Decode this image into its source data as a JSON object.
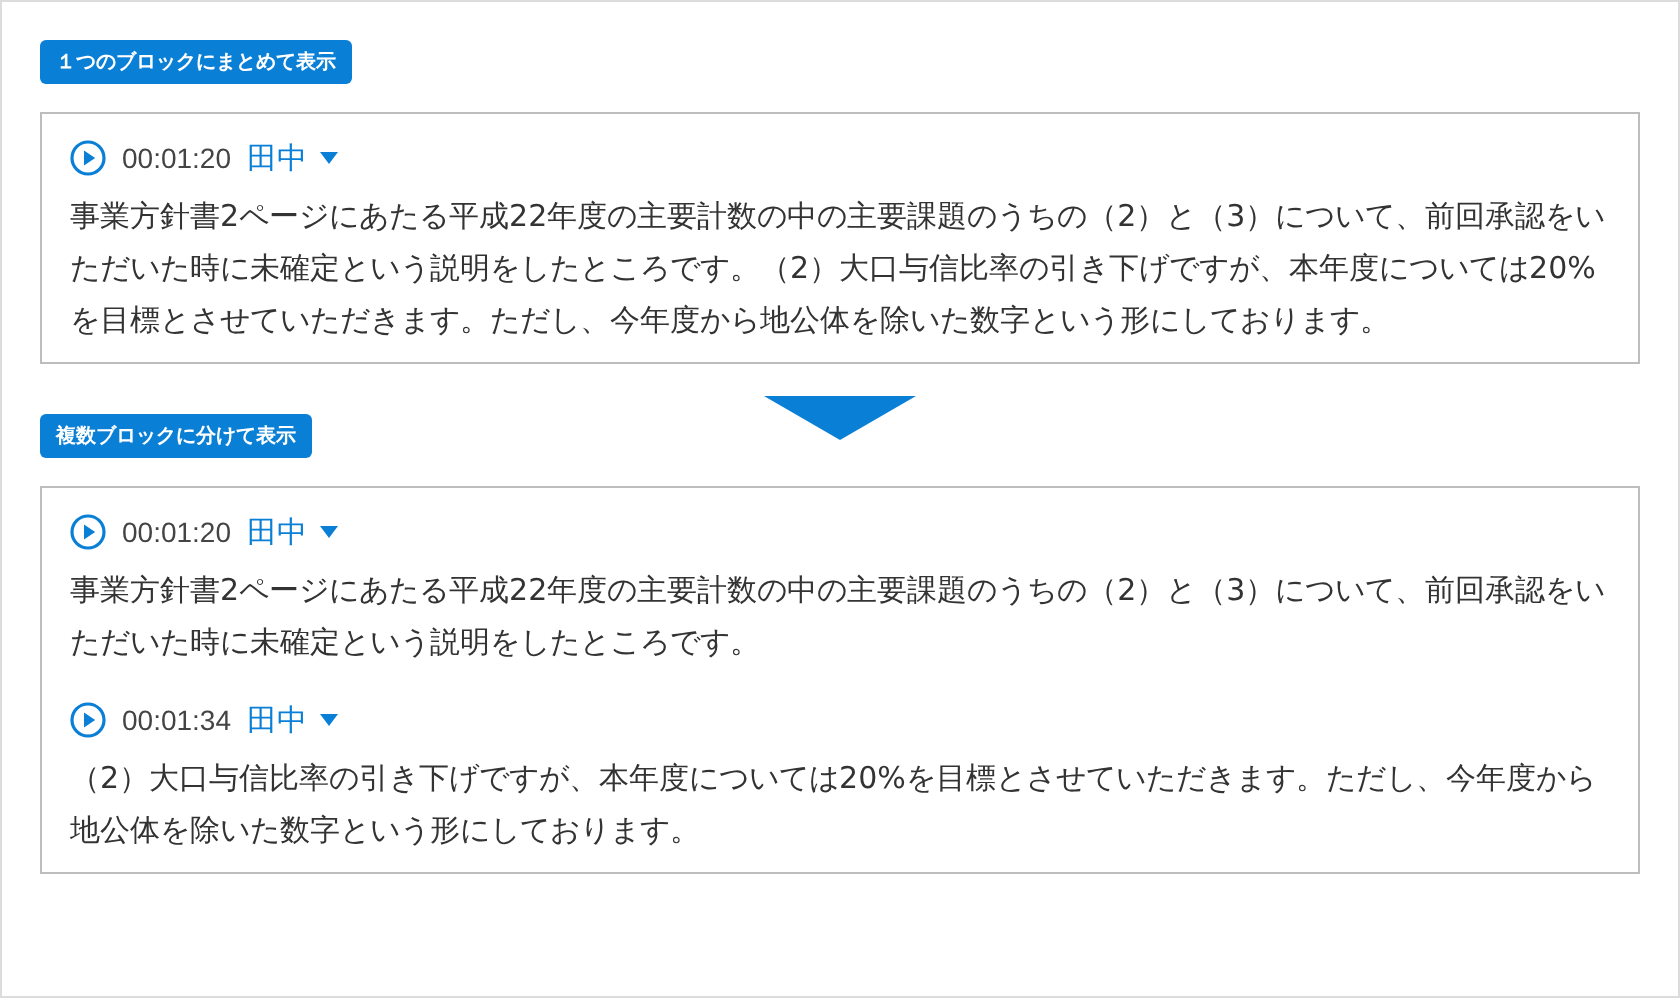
{
  "sections": [
    {
      "label": "１つのブロックにまとめて表示",
      "blocks": [
        {
          "time": "00:01:20",
          "speaker": "田中",
          "text": "事業方針書2ページにあたる平成22年度の主要計数の中の主要課題のうちの（2）と（3）について、前回承認をいただいた時に未確定という説明をしたところです。（2）大口与信比率の引き下げですが、本年度については20%を目標とさせていただきます。ただし、今年度から地公体を除いた数字という形にしております。"
        }
      ]
    },
    {
      "label": "複数ブロックに分けて表示",
      "blocks": [
        {
          "time": "00:01:20",
          "speaker": "田中",
          "text": "事業方針書2ページにあたる平成22年度の主要計数の中の主要課題のうちの（2）と（3）について、前回承認をいただいた時に未確定という説明をしたところです。"
        },
        {
          "time": "00:01:34",
          "speaker": "田中",
          "text": "（2）大口与信比率の引き下げですが、本年度については20%を目標とさせていただきます。ただし、今年度から地公体を除いた数字という形にしております。"
        }
      ]
    }
  ]
}
